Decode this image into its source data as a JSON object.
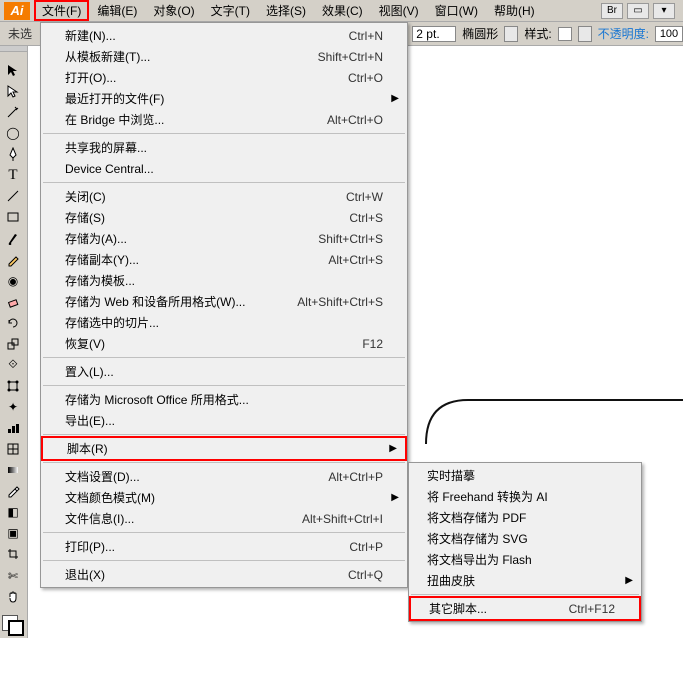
{
  "menubar": {
    "items": [
      "文件(F)",
      "编辑(E)",
      "对象(O)",
      "文字(T)",
      "选择(S)",
      "效果(C)",
      "视图(V)",
      "窗口(W)",
      "帮助(H)"
    ],
    "br": "Br",
    "doc": "▭"
  },
  "toolbar2": {
    "left_label": "未选",
    "stroke_val": "2 pt.",
    "stroke_shape": "椭圆形",
    "style_label": "样式:",
    "opacity_label": "不透明度:",
    "opacity_val": "100"
  },
  "file_menu": [
    {
      "label": "新建(N)...",
      "shortcut": "Ctrl+N"
    },
    {
      "label": "从模板新建(T)...",
      "shortcut": "Shift+Ctrl+N"
    },
    {
      "label": "打开(O)...",
      "shortcut": "Ctrl+O"
    },
    {
      "label": "最近打开的文件(F)",
      "shortcut": "",
      "arrow": true
    },
    {
      "label": "在 Bridge 中浏览...",
      "shortcut": "Alt+Ctrl+O"
    },
    {
      "sep": true
    },
    {
      "label": "共享我的屏幕...",
      "shortcut": ""
    },
    {
      "label": "Device Central...",
      "shortcut": ""
    },
    {
      "sep": true
    },
    {
      "label": "关闭(C)",
      "shortcut": "Ctrl+W"
    },
    {
      "label": "存储(S)",
      "shortcut": "Ctrl+S"
    },
    {
      "label": "存储为(A)...",
      "shortcut": "Shift+Ctrl+S"
    },
    {
      "label": "存储副本(Y)...",
      "shortcut": "Alt+Ctrl+S"
    },
    {
      "label": "存储为模板...",
      "shortcut": ""
    },
    {
      "label": "存储为 Web 和设备所用格式(W)...",
      "shortcut": "Alt+Shift+Ctrl+S"
    },
    {
      "label": "存储选中的切片...",
      "shortcut": ""
    },
    {
      "label": "恢复(V)",
      "shortcut": "F12"
    },
    {
      "sep": true
    },
    {
      "label": "置入(L)...",
      "shortcut": ""
    },
    {
      "sep": true
    },
    {
      "label": "存储为 Microsoft Office 所用格式...",
      "shortcut": ""
    },
    {
      "label": "导出(E)...",
      "shortcut": ""
    },
    {
      "sep": true
    },
    {
      "label": "脚本(R)",
      "shortcut": "",
      "arrow": true,
      "highlight": true
    },
    {
      "sep": true
    },
    {
      "label": "文档设置(D)...",
      "shortcut": "Alt+Ctrl+P"
    },
    {
      "label": "文档颜色模式(M)",
      "shortcut": "",
      "arrow": true
    },
    {
      "label": "文件信息(I)...",
      "shortcut": "Alt+Shift+Ctrl+I"
    },
    {
      "sep": true
    },
    {
      "label": "打印(P)...",
      "shortcut": "Ctrl+P"
    },
    {
      "sep": true
    },
    {
      "label": "退出(X)",
      "shortcut": "Ctrl+Q"
    }
  ],
  "script_submenu": [
    {
      "label": "实时描摹",
      "shortcut": ""
    },
    {
      "label": "将 Freehand 转换为 AI",
      "shortcut": ""
    },
    {
      "label": "将文档存储为 PDF",
      "shortcut": ""
    },
    {
      "label": "将文档存储为 SVG",
      "shortcut": ""
    },
    {
      "label": "将文档导出为 Flash",
      "shortcut": ""
    },
    {
      "label": "扭曲皮肤",
      "shortcut": "",
      "arrow": true
    },
    {
      "sep": true
    },
    {
      "label": "其它脚本...",
      "shortcut": "Ctrl+F12",
      "highlight": true
    }
  ],
  "tools": {
    "icons": [
      "▭",
      "⬚",
      "➤",
      "✦",
      "✎",
      "T",
      "╱",
      "▭",
      "✂",
      "↻",
      "◧",
      "◐",
      "▦",
      "⬚",
      "◉",
      "✄",
      "◫",
      "✋"
    ]
  }
}
